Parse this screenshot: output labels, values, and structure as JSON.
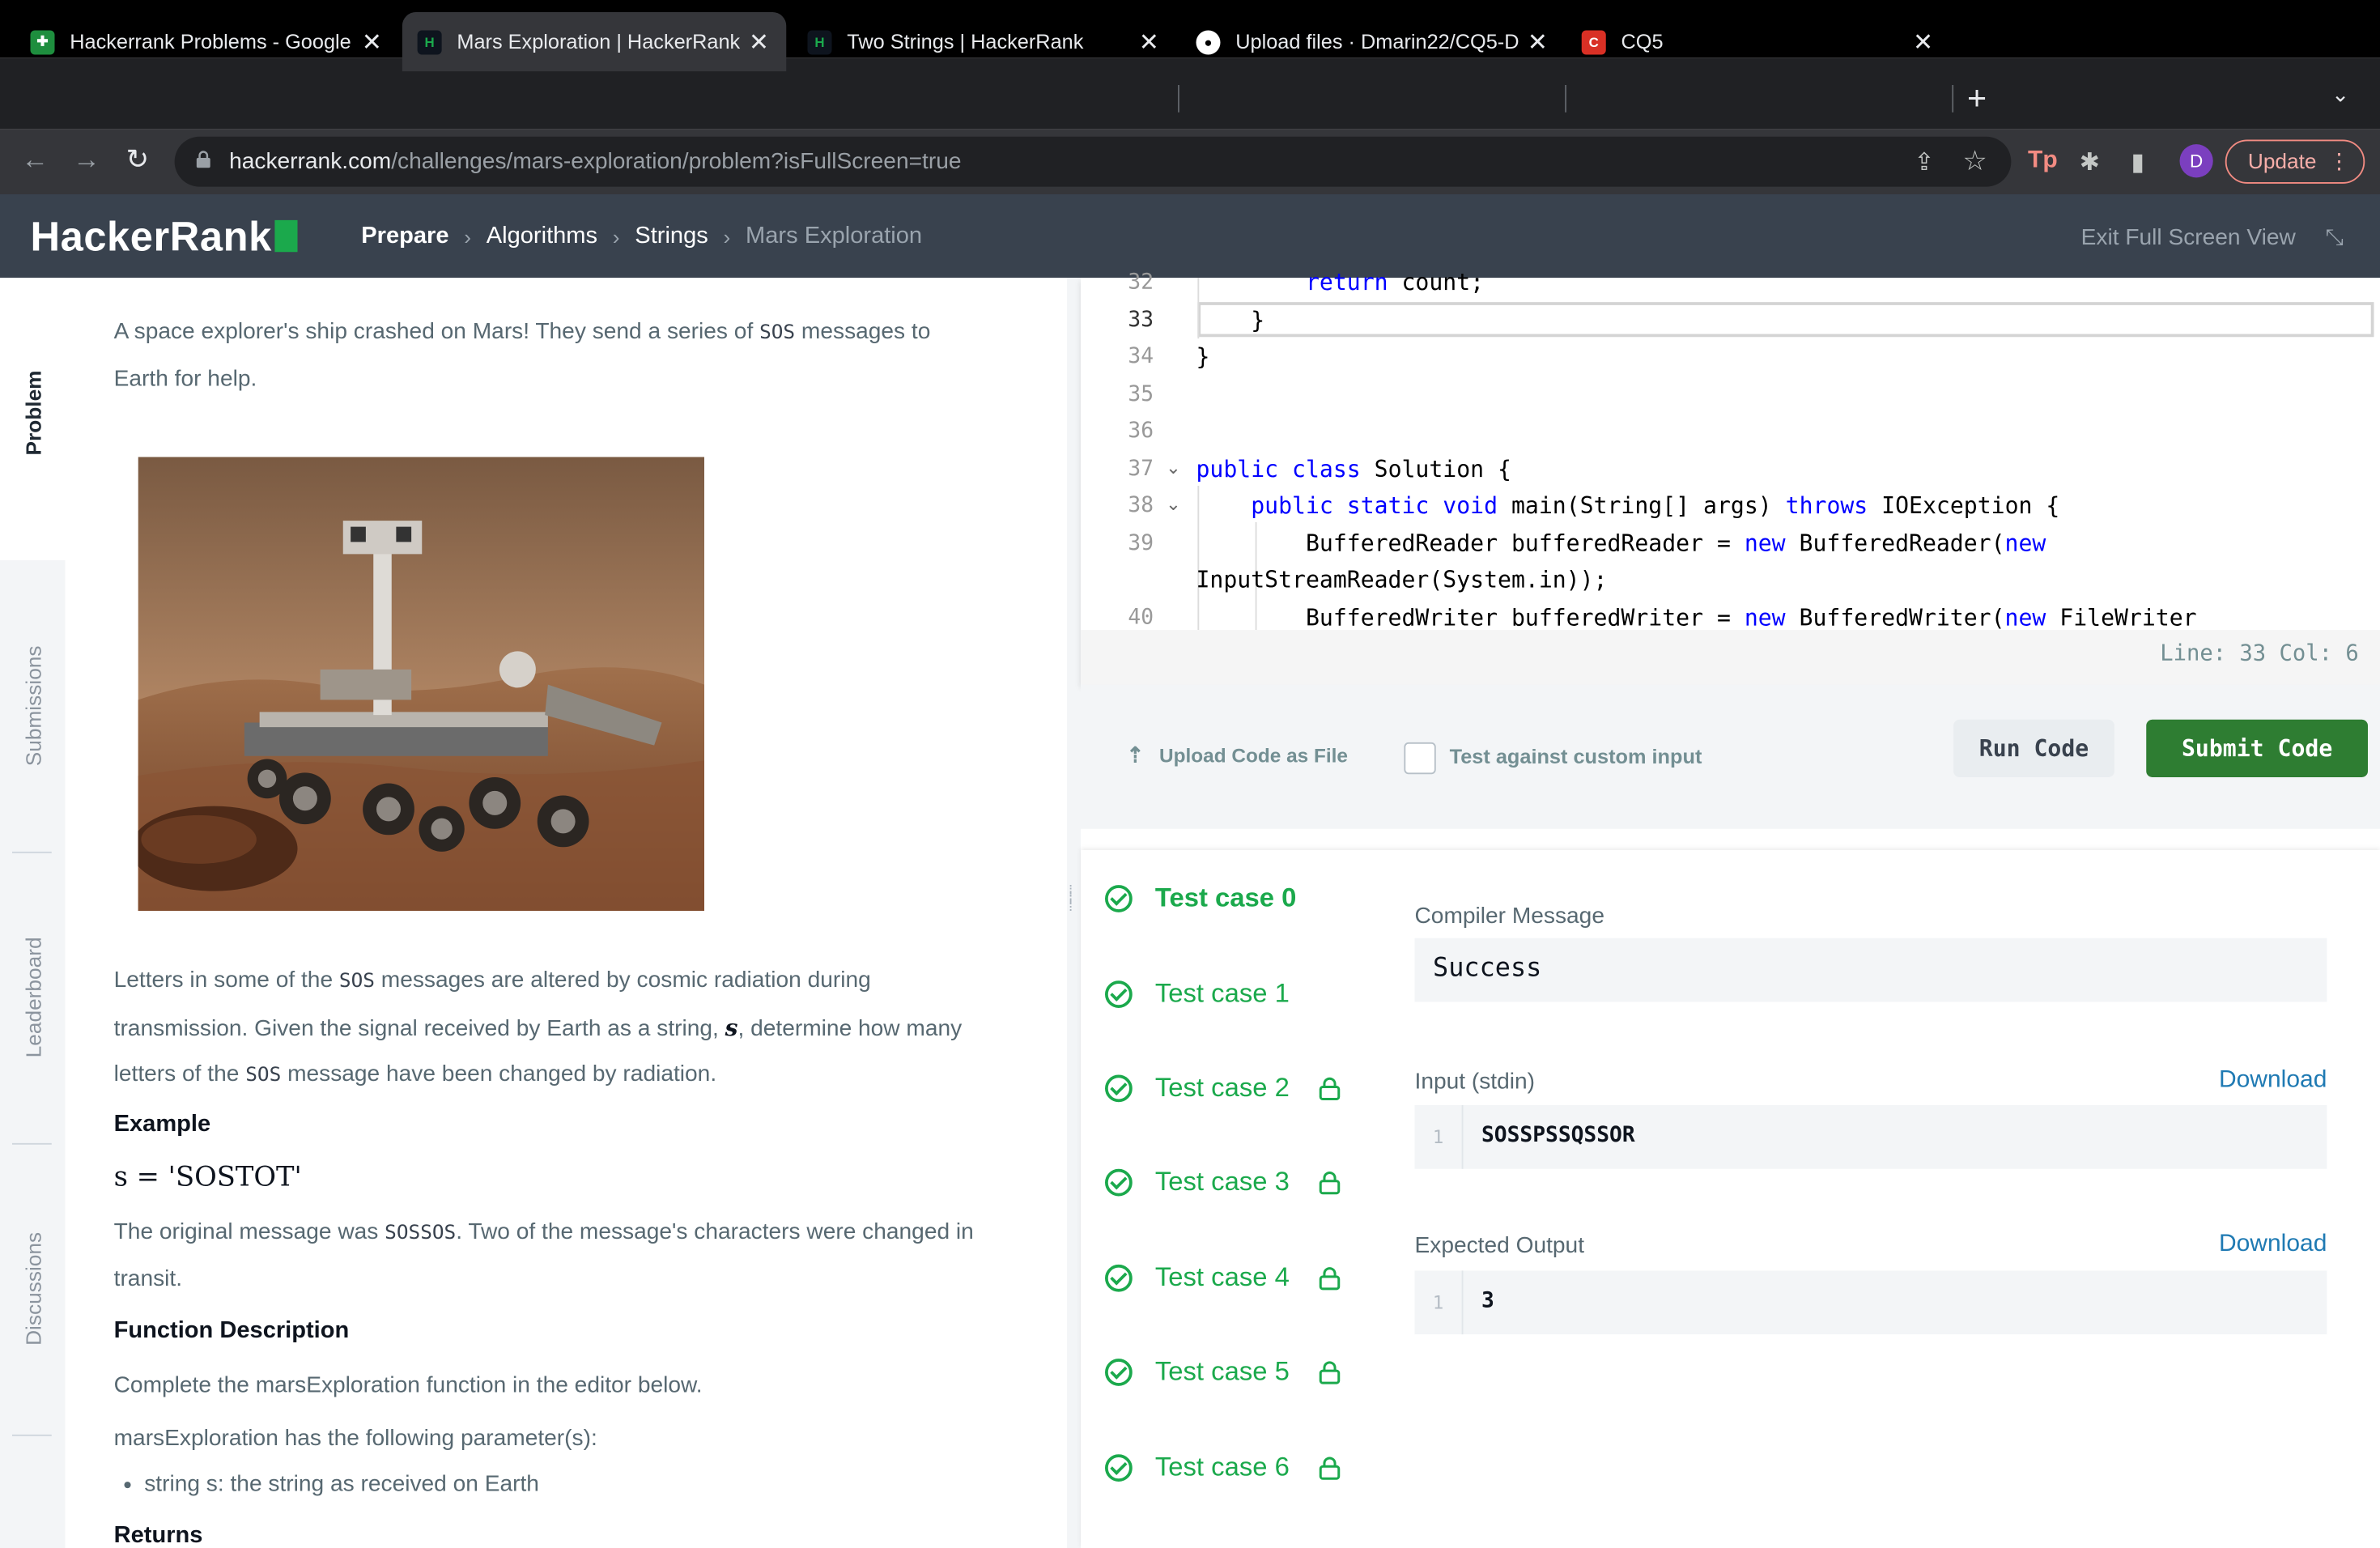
{
  "browser": {
    "tabs": [
      {
        "title": "Hackerrank Problems - Google",
        "favicon_color": "#1e8e3e",
        "active": false
      },
      {
        "title": "Mars Exploration | HackerRank",
        "favicon_color": "#1ba94c",
        "active": true
      },
      {
        "title": "Two Strings | HackerRank",
        "favicon_color": "#1ba94c",
        "active": false
      },
      {
        "title": "Upload files · Dmarin22/CQ5-D",
        "favicon_color": "#ffffff",
        "active": false
      },
      {
        "title": "CQ5",
        "favicon_color": "#d93025",
        "active": false
      }
    ],
    "url_host": "hackerrank.com",
    "url_path": "/challenges/mars-exploration/problem?isFullScreen=true",
    "avatar_letter": "D",
    "update_label": "Update"
  },
  "header": {
    "logo": "HackerRank",
    "breadcrumbs": [
      "Prepare",
      "Algorithms",
      "Strings",
      "Mars Exploration"
    ],
    "exit_fullscreen": "Exit Full Screen View"
  },
  "rail": [
    "Problem",
    "Submissions",
    "Leaderboard",
    "Discussions"
  ],
  "problem": {
    "intro_a": "A space explorer's ship crashed on Mars! They send a series of ",
    "sos": "SOS",
    "intro_b": " messages to",
    "intro_c": "Earth for help.",
    "p2_a": "Letters in some of the ",
    "p2_b": " messages are altered by cosmic radiation during",
    "p2_c": "transmission. Given the signal received by Earth as a string, ",
    "var_s": "s",
    "p2_d": ", determine how many",
    "p2_e": "letters of the ",
    "p2_f": " message have been changed by radiation.",
    "example_heading": "Example",
    "example_math": "s = 'SOSTOT'",
    "orig_a": "The original message was ",
    "orig_code": "SOSSOS",
    "orig_b": ". Two of the message's characters were changed in",
    "orig_c": "transit.",
    "func_heading": "Function Description",
    "func_text": "Complete the marsExploration function in the editor below.",
    "params_text": "marsExploration has the following parameter(s):",
    "param_item": "string s: the string as received on Earth",
    "returns_heading": "Returns"
  },
  "editor": {
    "lines": [
      {
        "num": "32",
        "code": "        return count;"
      },
      {
        "num": "33",
        "code": "    }"
      },
      {
        "num": "34",
        "code": "}"
      },
      {
        "num": "35",
        "code": ""
      },
      {
        "num": "36",
        "code": ""
      },
      {
        "num": "37",
        "code": "public class Solution {"
      },
      {
        "num": "38",
        "code": "    public static void main(String[] args) throws IOException {"
      },
      {
        "num": "39",
        "code": "        BufferedReader bufferedReader = new BufferedReader(new"
      },
      {
        "num": "",
        "code": "InputStreamReader(System.in));"
      },
      {
        "num": "40",
        "code": "        BufferedWriter bufferedWriter = new BufferedWriter(new FileWriter"
      }
    ],
    "status": "Line: 33 Col: 6"
  },
  "actions": {
    "upload": "Upload Code as File",
    "custom_input": "Test against custom input",
    "run": "Run Code",
    "submit": "Submit Code"
  },
  "results": {
    "test_cases": [
      {
        "label": "Test case 0",
        "locked": false
      },
      {
        "label": "Test case 1",
        "locked": false
      },
      {
        "label": "Test case 2",
        "locked": true
      },
      {
        "label": "Test case 3",
        "locked": true
      },
      {
        "label": "Test case 4",
        "locked": true
      },
      {
        "label": "Test case 5",
        "locked": true
      },
      {
        "label": "Test case 6",
        "locked": true
      }
    ],
    "compiler_label": "Compiler Message",
    "compiler_value": "Success",
    "input_label": "Input (stdin)",
    "input_line": "1",
    "input_value": "SOSSPSSQSSOR",
    "output_label": "Expected Output",
    "output_line": "1",
    "output_value": "3",
    "download": "Download"
  }
}
